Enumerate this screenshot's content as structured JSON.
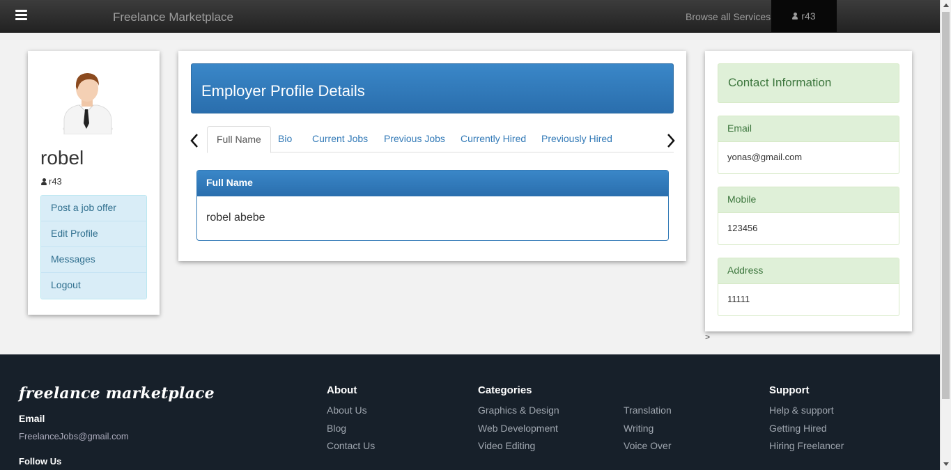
{
  "navbar": {
    "brand": "Freelance Marketplace",
    "browse_link": "Browse all Services",
    "username": "r43"
  },
  "profile": {
    "name": "robel",
    "username": "r43",
    "menu": [
      {
        "label": "Post a job offer"
      },
      {
        "label": "Edit Profile"
      },
      {
        "label": "Messages"
      },
      {
        "label": "Logout"
      }
    ]
  },
  "employer": {
    "title": "Employer Profile Details",
    "tabs": [
      {
        "label": "Full Name",
        "active": true
      },
      {
        "label": "Bio"
      },
      {
        "label": "Current Jobs"
      },
      {
        "label": "Previous Jobs"
      },
      {
        "label": "Currently Hired"
      },
      {
        "label": "Previously Hired"
      }
    ],
    "panel_title": "Full Name",
    "panel_value": "robel abebe"
  },
  "contact": {
    "title": "Contact Information",
    "email_label": "Email",
    "email_value": "yonas@gmail.com",
    "mobile_label": "Mobile",
    "mobile_value": "123456",
    "address_label": "Address",
    "address_value": "11111",
    "stray_text": ">"
  },
  "footer": {
    "brand": "freelance marketplace",
    "email_label": "Email",
    "email_value": "FreelanceJobs@gmail.com",
    "follow_label": "Follow Us",
    "about": {
      "heading": "About",
      "links": [
        "About Us",
        "Blog",
        "Contact Us"
      ]
    },
    "categories": {
      "heading": "Categories",
      "col1": [
        "Graphics & Design",
        "Web Development",
        "Video Editing"
      ],
      "col2": [
        "Translation",
        "Writing",
        "Voice Over"
      ]
    },
    "support": {
      "heading": "Support",
      "links": [
        "Help & support",
        "Getting Hired",
        "Hiring Freelancer"
      ]
    }
  },
  "colors": {
    "navbar": "#222222",
    "primary_panel": "#337ab7",
    "info_panel": "#d9edf7",
    "success_panel": "#dff0d8",
    "footer": "#17202a"
  },
  "icons": [
    "hamburger-icon",
    "user-icon",
    "chevron-left-icon",
    "chevron-right-icon",
    "avatar"
  ]
}
